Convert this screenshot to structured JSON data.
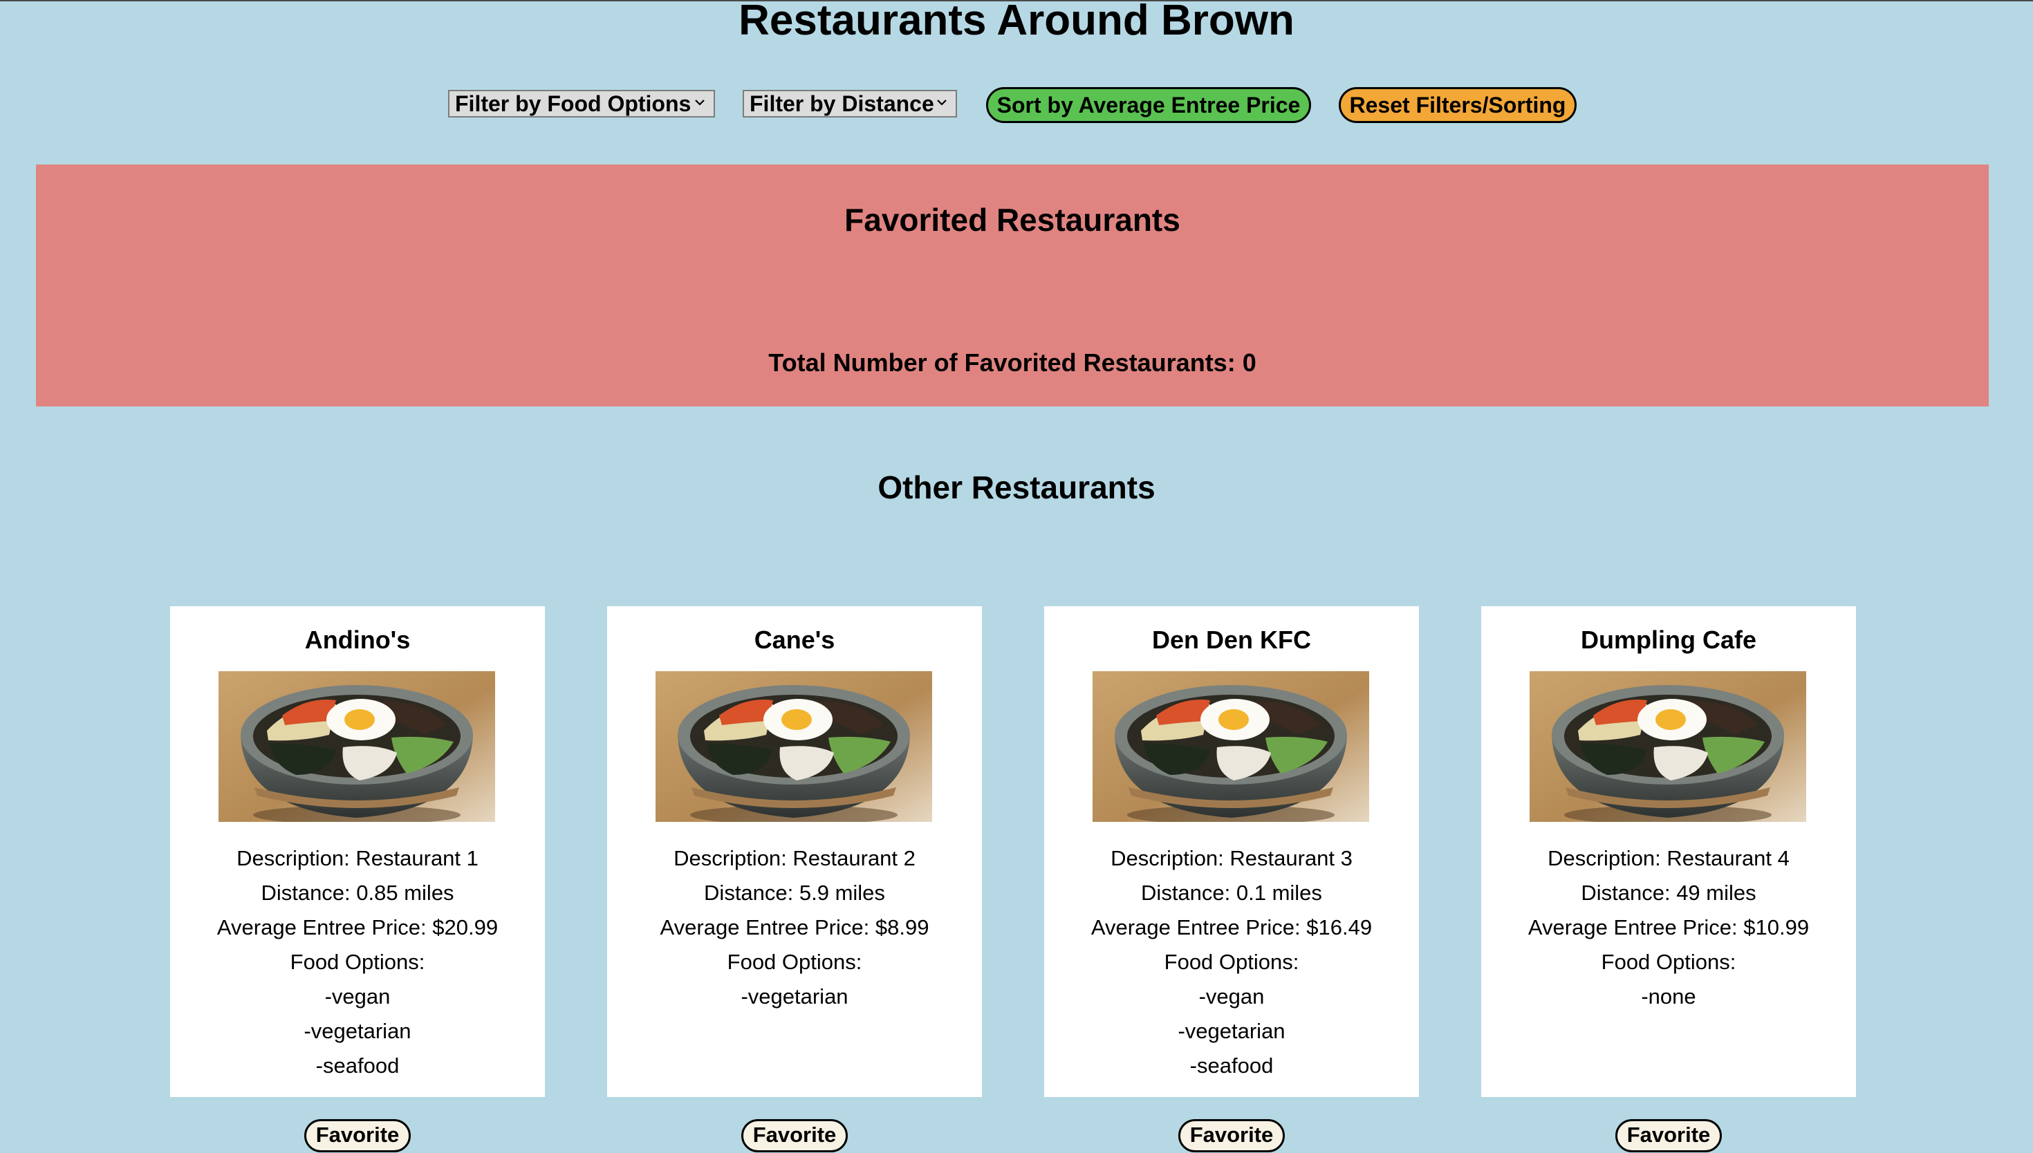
{
  "page": {
    "title": "Restaurants Around Brown"
  },
  "controls": {
    "food_filter_label": "Filter by Food Options",
    "distance_filter_label": "Filter by Distance",
    "sort_label": "Sort by Average Entree Price",
    "reset_label": "Reset Filters/Sorting",
    "chevron_icon": "chevron-down-icon",
    "colors": {
      "sort_bg": "#5ac251",
      "reset_bg": "#f3a736"
    }
  },
  "favorites": {
    "title": "Favorited Restaurants",
    "total_label": "Total Number of Favorited Restaurants: 0",
    "bg_color": "#e08481"
  },
  "other": {
    "title": "Other Restaurants"
  },
  "restaurants": [
    {
      "name": "Andino's",
      "image_icon": "bibimbap-photo",
      "description": "Description: Restaurant 1",
      "distance": "Distance: 0.85 miles",
      "price": "Average Entree Price: $20.99",
      "food_options_label": "Food Options:",
      "food_options": [
        "-vegan",
        "-vegetarian",
        "-seafood"
      ],
      "button_label": "Favorite"
    },
    {
      "name": "Cane's",
      "image_icon": "bibimbap-photo",
      "description": "Description: Restaurant 2",
      "distance": "Distance: 5.9 miles",
      "price": "Average Entree Price: $8.99",
      "food_options_label": "Food Options:",
      "food_options": [
        "-vegetarian"
      ],
      "button_label": "Favorite"
    },
    {
      "name": "Den Den KFC",
      "image_icon": "bibimbap-photo",
      "description": "Description: Restaurant 3",
      "distance": "Distance: 0.1 miles",
      "price": "Average Entree Price: $16.49",
      "food_options_label": "Food Options:",
      "food_options": [
        "-vegan",
        "-vegetarian",
        "-seafood"
      ],
      "button_label": "Favorite"
    },
    {
      "name": "Dumpling Cafe",
      "image_icon": "bibimbap-photo",
      "description": "Description: Restaurant 4",
      "distance": "Distance: 49 miles",
      "price": "Average Entree Price: $10.99",
      "food_options_label": "Food Options:",
      "food_options": [
        "-none"
      ],
      "button_label": "Favorite"
    }
  ],
  "colors": {
    "page_bg": "#b5d8e4",
    "card_bg": "#ffffff",
    "favorite_button_bg": "#f7f2e4"
  }
}
